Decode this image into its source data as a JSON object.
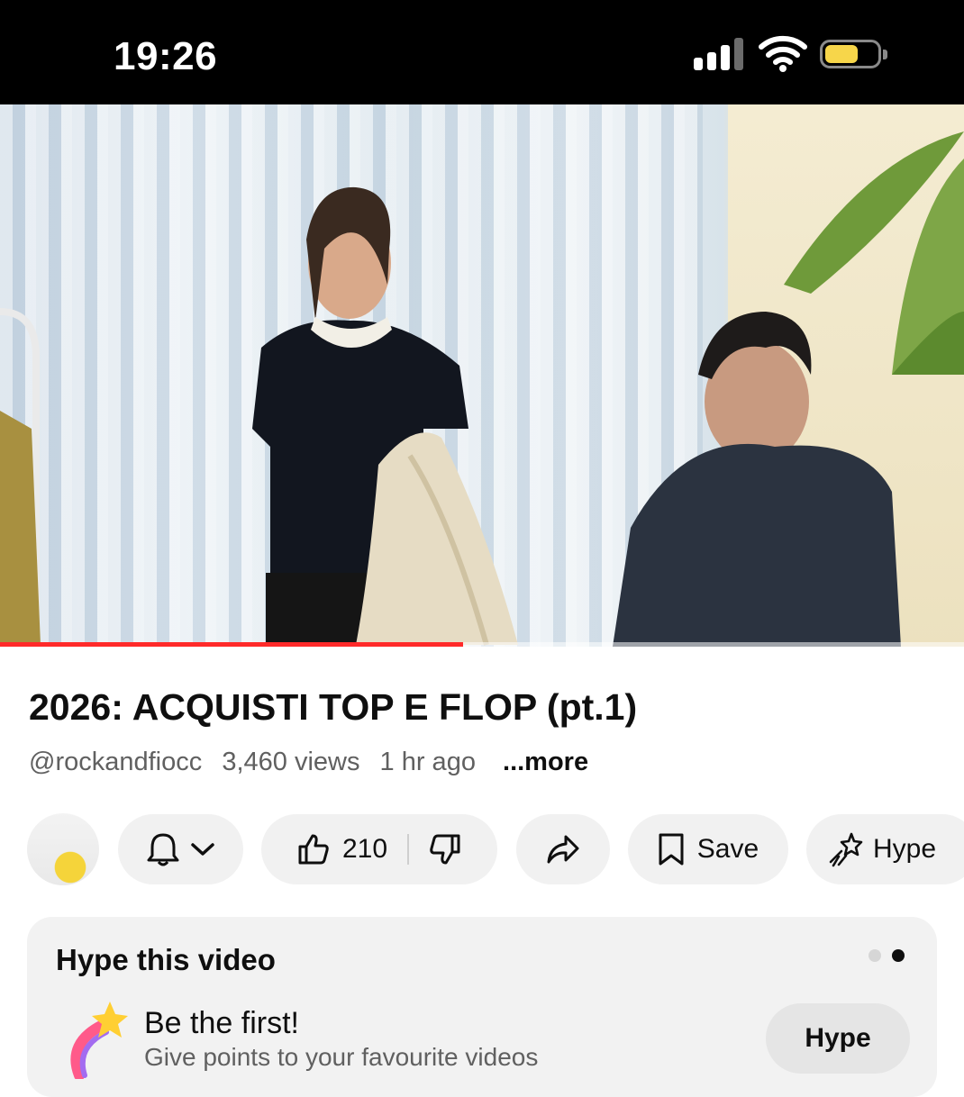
{
  "status_bar": {
    "time": "19:26"
  },
  "video": {
    "progress_fraction": 0.48
  },
  "info": {
    "title": "2026: ACQUISTI TOP E FLOP (pt.1)",
    "channel_handle": "@rockandfiocc",
    "views": "3,460 views",
    "age": "1 hr ago",
    "more": "...more"
  },
  "actions": {
    "likes": "210",
    "save_label": "Save",
    "hype_label": "Hype"
  },
  "hype_card": {
    "title": "Hype this video",
    "headline": "Be the first!",
    "subtitle": "Give points to your favourite videos",
    "button": "Hype"
  },
  "colors": {
    "progress": "#ff2a2a",
    "accent_battery": "#f7d64a"
  }
}
